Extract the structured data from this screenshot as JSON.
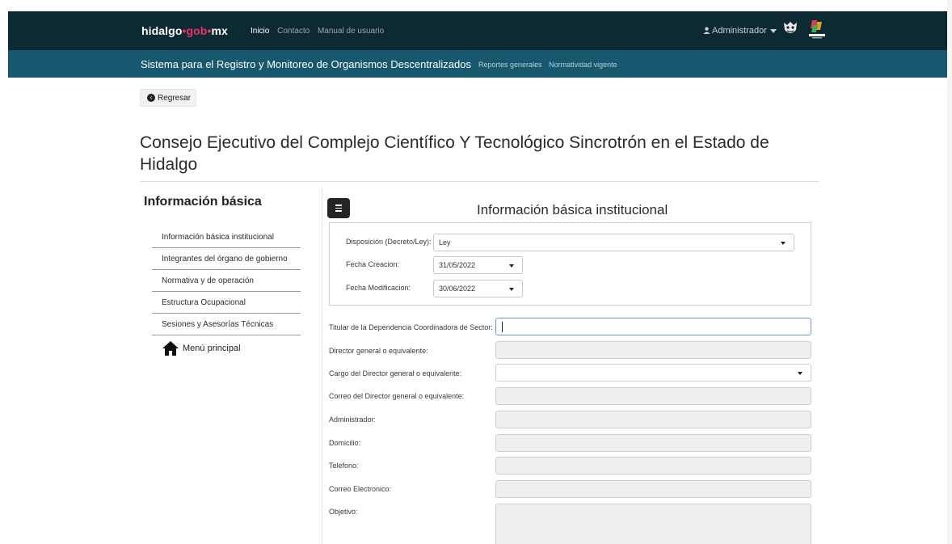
{
  "topbar": {
    "brand": {
      "part1": "hidalgo",
      "sep": "•",
      "part2": "gob",
      "part3": "mx"
    },
    "nav": [
      "Inicio",
      "Contacto",
      "Manual de usuario"
    ],
    "user": "Administrador"
  },
  "subbar": {
    "title": "Sistema para el Registro y Monitoreo de Organismos Descentralizados",
    "links": [
      "Reportes generales",
      "Normatividad vigente"
    ]
  },
  "back_label": "Regresar",
  "page_title": "Consejo Ejecutivo del Complejo Científico Y Tecnológico Sincrotrón en el Estado de Hidalgo",
  "sidebar": {
    "title": "Información básica",
    "items": [
      "Información básica institucional",
      "Integrantes del órgano de gobierno",
      "Normativa y de operación",
      "Estructura Ocupacional",
      "Sesiones y Asesorías Técnicas"
    ],
    "home": "Menú principal"
  },
  "form": {
    "title": "Información básica institucional",
    "disposicion": {
      "label": "Disposición (Decreto/Ley):",
      "value": "Ley"
    },
    "fecha_creacion": {
      "label": "Fecha Creacion:",
      "value": "31/05/2022"
    },
    "fecha_modificacion": {
      "label": "Fecha Modificacion:",
      "value": "30/06/2022"
    },
    "fields": {
      "titular": "Titular de la Dependencia Coordinadora de Sector:",
      "director": "Director general o equivalente:",
      "cargo": "Cargo del Director general o equivalente:",
      "correo_director": "Correo del Director general o equivalente:",
      "administrador": "Administrador:",
      "domicilio": "Domicilio:",
      "telefono": "Telefono:",
      "correo": "Correo Electronico:",
      "objetivo": "Objetivo:"
    }
  },
  "colors": {
    "topbar": "#0d2a33",
    "subbar": "#17586e",
    "brand_accent": "#e8336a"
  }
}
